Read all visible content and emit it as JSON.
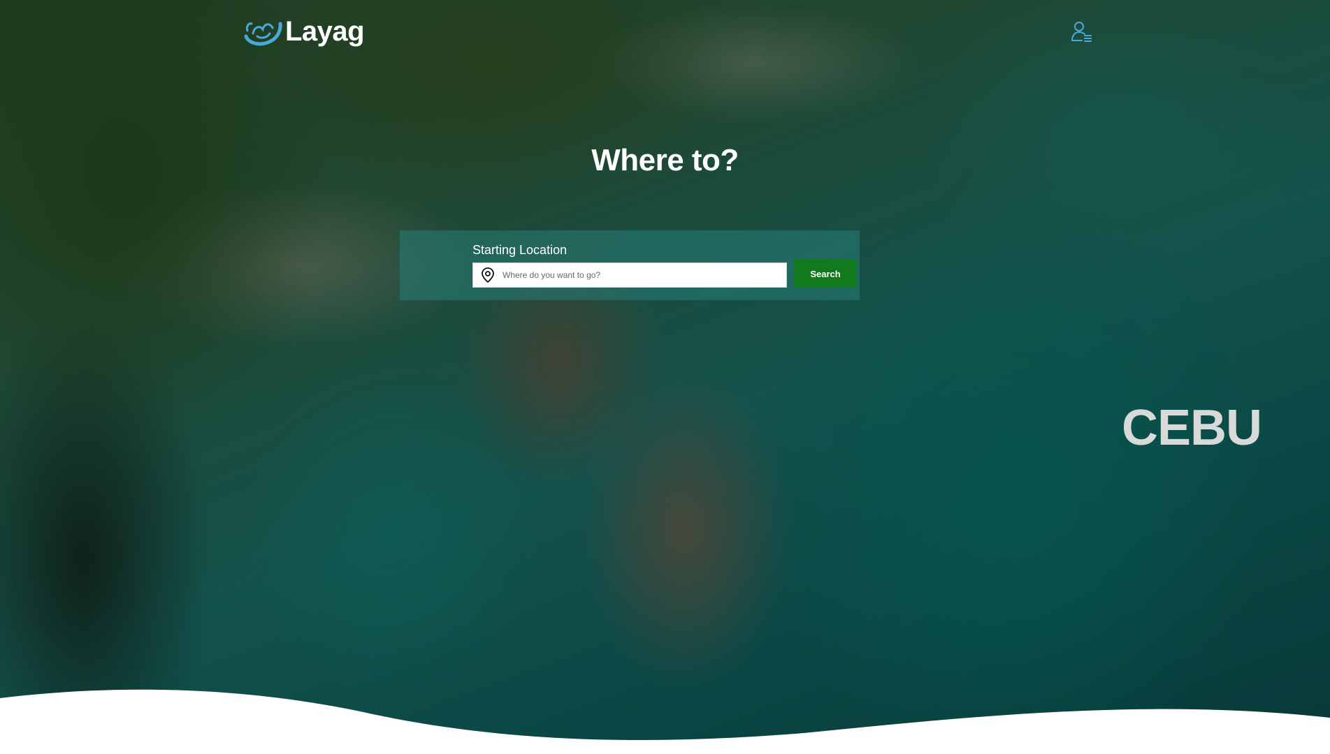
{
  "header": {
    "brand": "Layag",
    "user_icon": "user-menu-icon"
  },
  "hero": {
    "title": "Where to?",
    "destination": "CEBU"
  },
  "search": {
    "label": "Starting Location",
    "placeholder": "Where do you want to go?",
    "value": "",
    "button_label": "Search",
    "location_icon": "map-pin-icon"
  },
  "colors": {
    "accent": "#4da8da",
    "search_button": "#127a1e",
    "panel": "#28827d"
  }
}
